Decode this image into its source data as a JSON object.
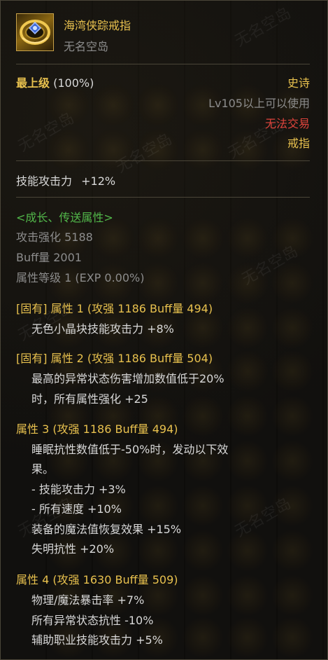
{
  "item": {
    "name": "海湾侠踪戒指",
    "source": "无名空岛",
    "grade_label": "最上级",
    "grade_value": "(100%)",
    "rarity": "史诗",
    "level_req": "Lv105以上可以使用",
    "trade": "无法交易",
    "type": "戒指",
    "icon": "ring-icon"
  },
  "base_stat": {
    "label": "技能攻击力",
    "value": "+12%"
  },
  "growth": {
    "header": "<成长、传送属性>",
    "attack_label": "攻击强化 5188",
    "buff_label": "Buff量 2001",
    "level_label": "属性等级 1 (EXP 0.00%)"
  },
  "attributes": [
    {
      "header": "[固有] 属性 1 (攻强 1186    Buff量 494)",
      "lines": [
        "无色小晶块技能攻击力 +8%"
      ]
    },
    {
      "header": "[固有] 属性 2 (攻强 1186    Buff量 504)",
      "lines": [
        "最高的异常状态伤害增加数值低于20%",
        "时，所有属性强化 +25"
      ]
    },
    {
      "header": "属性 3 (攻强 1186    Buff量 494)",
      "lines": [
        "睡眠抗性数值低于-50%时，发动以下效",
        "果。",
        "- 技能攻击力 +3%",
        "- 所有速度 +10%",
        "装备的魔法值恢复效果 +15%",
        "失明抗性 +20%"
      ]
    },
    {
      "header": "属性 4 (攻强 1630    Buff量 509)",
      "lines": [
        "物理/魔法暴击率 +7%",
        "所有异常状态抗性 -10%",
        "辅助职业技能攻击力 +5%"
      ]
    }
  ],
  "watermark": "无名空岛",
  "colors": {
    "gold": "#e8c14e",
    "gray": "#8c8c8c",
    "red": "#e0443c",
    "green": "#52b84a",
    "white": "#d8d8d8"
  }
}
